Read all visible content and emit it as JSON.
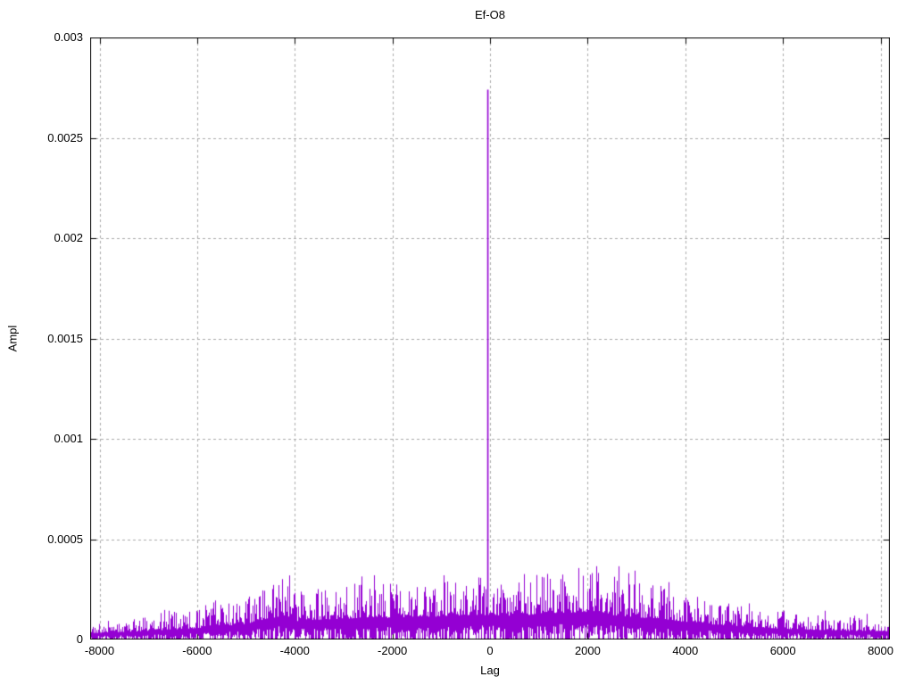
{
  "chart_data": {
    "type": "line",
    "style": "impulse-like vertical-fill correlation trace",
    "title": "Ef-O8",
    "xlabel": "Lag",
    "ylabel": "Ampl",
    "xlim": [
      -8192,
      8191
    ],
    "ylim": [
      0,
      0.003
    ],
    "xticks": {
      "values": [
        -8000,
        -6000,
        -4000,
        -2000,
        0,
        2000,
        4000,
        6000,
        8000
      ],
      "labels": [
        "-8000",
        "-6000",
        "-4000",
        "-2000",
        "0",
        "2000",
        "4000",
        "6000",
        "8000"
      ]
    },
    "yticks": {
      "values": [
        0,
        0.0005,
        0.001,
        0.0015,
        0.002,
        0.0025,
        0.003
      ],
      "labels": [
        "0",
        "0.0005",
        "0.001",
        "0.0015",
        "0.002",
        "0.0025",
        "0.003"
      ]
    },
    "grid": true,
    "legend": "none",
    "peak": {
      "lag": -45,
      "ampl": 0.00274
    },
    "noise_envelope": [
      [
        -8192,
        8e-05
      ],
      [
        -7500,
        0.0001
      ],
      [
        -7000,
        0.00011
      ],
      [
        -6000,
        0.00015
      ],
      [
        -5000,
        0.0002
      ],
      [
        -4600,
        0.00027
      ],
      [
        -4200,
        0.00031
      ],
      [
        -4000,
        0.00024
      ],
      [
        -3500,
        0.00026
      ],
      [
        -3000,
        0.00027
      ],
      [
        -2500,
        0.00029
      ],
      [
        -2000,
        0.00028
      ],
      [
        -1500,
        0.0003
      ],
      [
        -1000,
        0.0003
      ],
      [
        -500,
        0.00032
      ],
      [
        0,
        0.00032
      ],
      [
        500,
        0.00031
      ],
      [
        1000,
        0.00033
      ],
      [
        1500,
        0.00035
      ],
      [
        2000,
        0.00036
      ],
      [
        2200,
        0.00038
      ],
      [
        2500,
        0.00032
      ],
      [
        3000,
        0.00029
      ],
      [
        3500,
        0.00027
      ],
      [
        4000,
        0.00023
      ],
      [
        4500,
        0.0002
      ],
      [
        5000,
        0.00018
      ],
      [
        5500,
        0.00016
      ],
      [
        6000,
        0.00014
      ],
      [
        6500,
        0.00013
      ],
      [
        7000,
        0.00012
      ],
      [
        7500,
        0.00011
      ],
      [
        8191,
        0.00011
      ]
    ],
    "render": {
      "seed": 1337,
      "columns": 896,
      "base_fraction": 0.38,
      "lo_fraction": 0.22,
      "zero_touch_probability": 0.35,
      "boost_probability": 0.05
    },
    "colors": {
      "series": "#9400d3",
      "grid": "#aaaaaa",
      "border": "#000000",
      "text": "#000000",
      "background": "#ffffff"
    }
  }
}
